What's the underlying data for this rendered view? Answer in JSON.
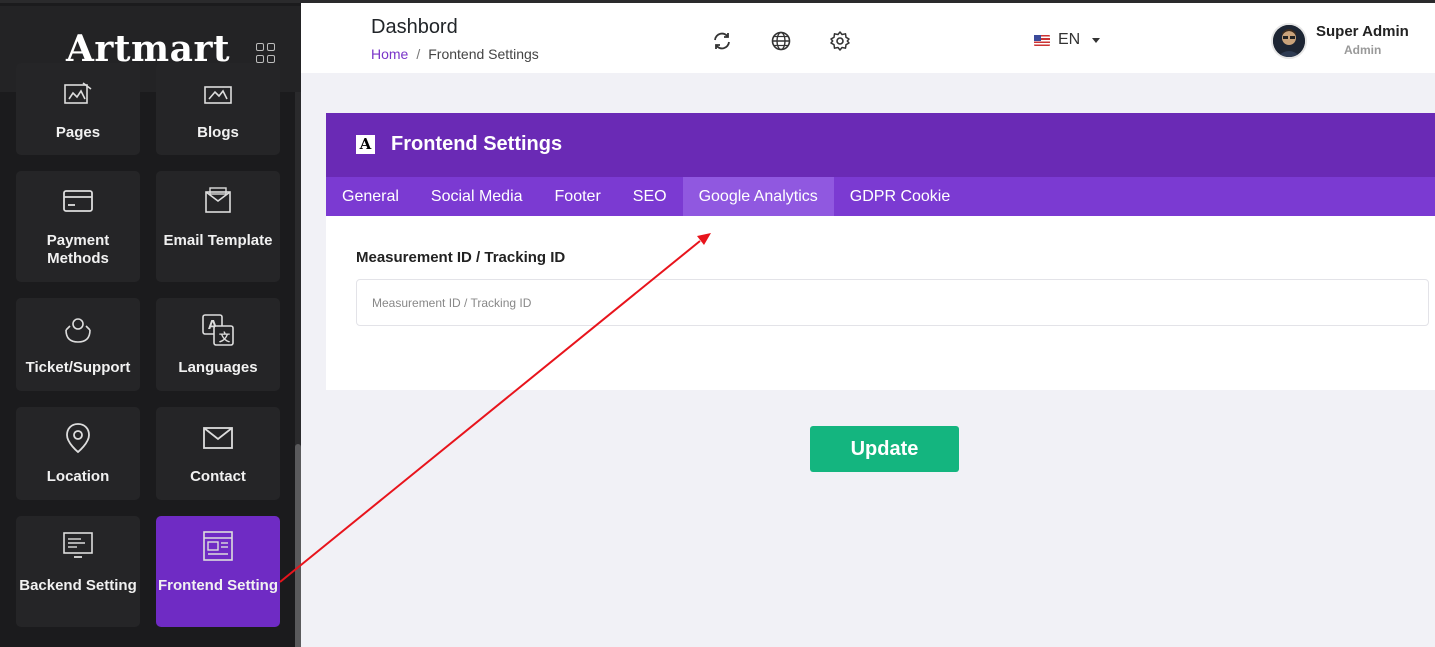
{
  "sidebar": {
    "logo": "Artmart",
    "tiles": [
      {
        "label": "Pages",
        "icon": "pages-icon"
      },
      {
        "label": "Blogs",
        "icon": "blogs-icon"
      },
      {
        "label": "Payment Methods",
        "icon": "credit-card-icon"
      },
      {
        "label": "Email Template",
        "icon": "email-template-icon"
      },
      {
        "label": "Ticket/Support",
        "icon": "support-icon"
      },
      {
        "label": "Languages",
        "icon": "translate-icon"
      },
      {
        "label": "Location",
        "icon": "map-pin-icon"
      },
      {
        "label": "Contact",
        "icon": "envelope-icon"
      },
      {
        "label": "Backend Setting",
        "icon": "monitor-icon"
      },
      {
        "label": "Frontend Setting",
        "icon": "layout-icon",
        "active": true
      }
    ]
  },
  "header": {
    "title": "Dashbord",
    "breadcrumb": {
      "home": "Home",
      "separator": "/",
      "current": "Frontend Settings"
    },
    "language": "EN",
    "user": {
      "name": "Super Admin",
      "role": "Admin"
    }
  },
  "card": {
    "title": "Frontend Settings",
    "tabs": [
      "General",
      "Social Media",
      "Footer",
      "SEO",
      "Google Analytics",
      "GDPR Cookie"
    ],
    "active_tab": "Google Analytics",
    "field_label": "Measurement ID / Tracking ID",
    "field_placeholder": "Measurement ID / Tracking ID",
    "field_value": ""
  },
  "actions": {
    "update_label": "Update"
  },
  "colors": {
    "sidebar_bg": "#1b1b1d",
    "tile_bg": "#252527",
    "accent_purple": "#6a2ab5",
    "tab_bar": "#7b3ad2",
    "active_tab": "#9058e0",
    "update_green": "#14b57f",
    "annotation_arrow": "#e8141c"
  }
}
